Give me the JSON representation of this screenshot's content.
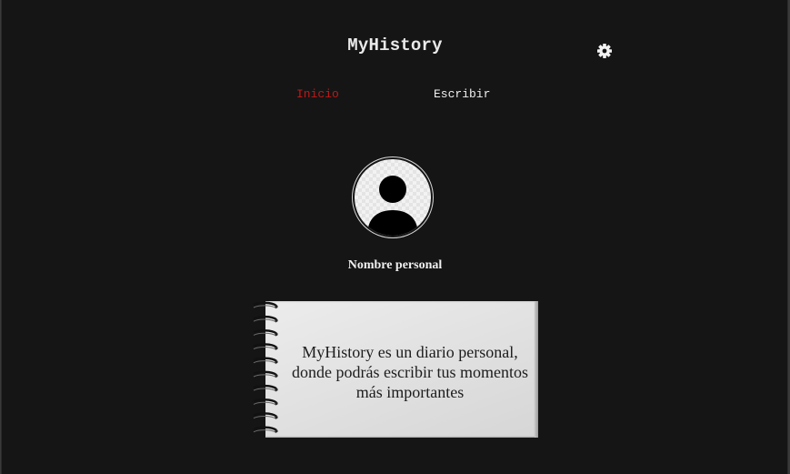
{
  "header": {
    "title": "MyHistory",
    "settings_icon": "gear-icon"
  },
  "nav": {
    "items": [
      {
        "label": "Inicio",
        "active": true,
        "color": "#c01818"
      },
      {
        "label": "Escribir",
        "active": false,
        "color": "#f0f0f0"
      }
    ]
  },
  "profile": {
    "avatar_icon": "user-silhouette-icon",
    "name": "Nombre personal"
  },
  "notebook": {
    "text": "MyHistory es un diario personal, donde podrás escribir tus momentos más importantes"
  },
  "colors": {
    "background": "#151515",
    "accent": "#c01818",
    "text": "#f0f0f0"
  }
}
